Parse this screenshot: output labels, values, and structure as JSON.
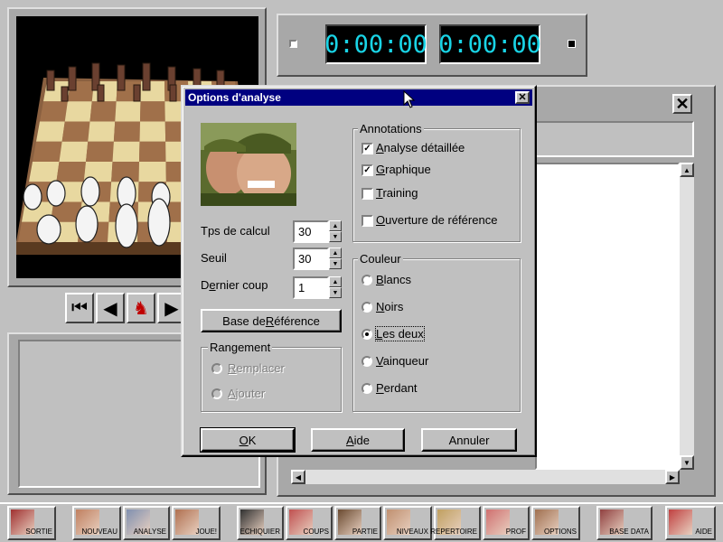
{
  "clocks": {
    "white": "0:00:00",
    "black": "0:00:00"
  },
  "dialog": {
    "title": "Options d'analyse",
    "close_glyph": "✕",
    "calc_time": {
      "label_pre": "Tps de calcul",
      "value": "30"
    },
    "threshold": {
      "label": "Seuil",
      "value": "30"
    },
    "last_move": {
      "label_pre": "D",
      "label_ul": "e",
      "label_post": "rnier coup",
      "value": "1"
    },
    "ref_base_button": {
      "pre": "Base de ",
      "ul": "R",
      "post": "éférence"
    },
    "storage": {
      "title": "Rangement",
      "options": [
        {
          "ul": "R",
          "rest": "emplacer"
        },
        {
          "ul": "A",
          "rest": "jouter"
        }
      ]
    },
    "annotations": {
      "title": "Annotations",
      "items": [
        {
          "pre": "",
          "ul": "A",
          "rest": "nalyse détaillée",
          "checked": true
        },
        {
          "pre": "",
          "ul": "G",
          "rest": "raphique",
          "checked": true
        },
        {
          "pre": "",
          "ul": "T",
          "rest": "raining",
          "checked": false
        },
        {
          "pre": "",
          "ul": "O",
          "rest": "uverture de référence",
          "checked": false
        }
      ]
    },
    "color": {
      "title": "Couleur",
      "options": [
        {
          "ul": "B",
          "rest": "lancs",
          "checked": false
        },
        {
          "ul": "N",
          "rest": "oirs",
          "checked": false
        },
        {
          "ul": "L",
          "rest": "es deux",
          "checked": true
        },
        {
          "ul": "V",
          "rest": "ainqueur",
          "checked": false
        },
        {
          "ul": "P",
          "rest": "erdant",
          "checked": false
        }
      ]
    },
    "ok": {
      "ul": "O",
      "rest": "K"
    },
    "help": {
      "ul": "A",
      "rest": "ide"
    },
    "cancel": "Annuler"
  },
  "toolbar": [
    {
      "label": "SORTIE"
    },
    {
      "label": "NOUVEAU"
    },
    {
      "label": "ANALYSE"
    },
    {
      "label": "JOUE!"
    },
    {
      "label": "ECHIQUIER"
    },
    {
      "label": "COUPS"
    },
    {
      "label": "PARTIE"
    },
    {
      "label": "NIVEAUX"
    },
    {
      "label": "REPERTOIRE"
    },
    {
      "label": "PROF"
    },
    {
      "label": "OPTIONS"
    },
    {
      "label": "BASE DATA"
    },
    {
      "label": "AIDE"
    }
  ],
  "colors": {
    "title_bar": "#000080",
    "clock_digits": "#19d4e6",
    "board_light": "#e8d8a0",
    "board_dark": "#a0704a"
  }
}
